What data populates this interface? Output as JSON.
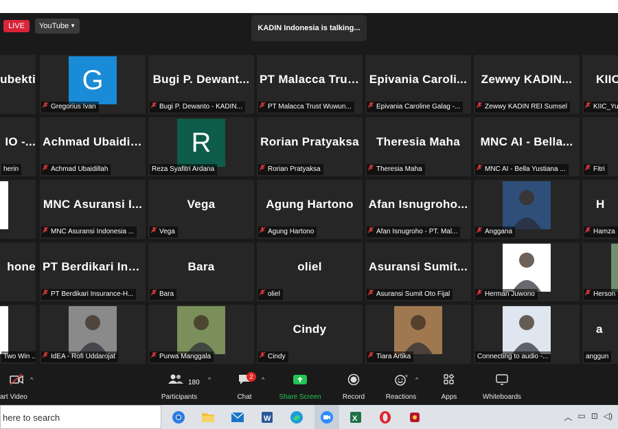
{
  "meeting": {
    "live_label": "LIVE",
    "stream_target": "YouTube",
    "speaker_banner": "KADIN Indonesia is talking..."
  },
  "tiles": [
    {
      "display": "ubekti",
      "label": "",
      "type": "name"
    },
    {
      "display": "G",
      "label": "Gregorius Ivan",
      "type": "avatar",
      "color": "#1a8bd6"
    },
    {
      "display": "Bugi P. Dewant...",
      "label": "Bugi P. Dewanto - KADIN...",
      "type": "name"
    },
    {
      "display": "PT Malacca Trus...",
      "label": "PT Malacca Trust Wuwun...",
      "type": "name"
    },
    {
      "display": "Epivania Caroli...",
      "label": "Epivania Caroline Galag -...",
      "type": "name"
    },
    {
      "display": "Zewwy KADIN...",
      "label": "Zewwy KADIN REI Sumsel",
      "type": "name"
    },
    {
      "display": "KIIC",
      "label": "KIIC_Yu",
      "type": "name"
    },
    {
      "display": "IO -...",
      "label": "herin",
      "type": "name",
      "nomic": true
    },
    {
      "display": "Achmad Ubaidil...",
      "label": "Achmad Ubaidillah",
      "type": "name"
    },
    {
      "display": "R",
      "label": "Reza Syafitri Ardana",
      "type": "avatar",
      "color": "#0e5c4a",
      "nomic": true
    },
    {
      "display": "Rorian Pratyaksa",
      "label": "Rorian Pratyaksa",
      "type": "name"
    },
    {
      "display": "Theresia Maha",
      "label": "Theresia Maha",
      "type": "name"
    },
    {
      "display": "MNC AI - Bella...",
      "label": "MNC AI - Bella Yustiana ...",
      "type": "name"
    },
    {
      "display": "",
      "label": "Fitri",
      "type": "name"
    },
    {
      "display": "",
      "label": "",
      "type": "photo-edge"
    },
    {
      "display": "MNC Asuransi I...",
      "label": "MNC Asuransi Indonesia ...",
      "type": "name"
    },
    {
      "display": "Vega",
      "label": "Vega",
      "type": "name"
    },
    {
      "display": "Agung Hartono",
      "label": "Agung Hartono",
      "type": "name"
    },
    {
      "display": "Afan Isnugroho...",
      "label": "Afan Isnugroho - PT. Mal...",
      "type": "name"
    },
    {
      "display": "",
      "label": "Anggana",
      "type": "photo",
      "color": "#2f4f7a"
    },
    {
      "display": "H",
      "label": "Hamza",
      "type": "name"
    },
    {
      "display": "hone",
      "label": "",
      "type": "name"
    },
    {
      "display": "PT Berdikari Ins...",
      "label": "PT Berdikari Insurance-H...",
      "type": "name"
    },
    {
      "display": "Bara",
      "label": "Bara",
      "type": "name"
    },
    {
      "display": "oliel",
      "label": "oliel",
      "type": "name"
    },
    {
      "display": "Asuransi Sumit...",
      "label": "Asuransi Sumit Oto Fijal",
      "type": "name"
    },
    {
      "display": "",
      "label": "Herman Juwono",
      "type": "photo",
      "color": "#ffffff"
    },
    {
      "display": "",
      "label": "Herson",
      "type": "photo-edge",
      "color": "#6f8f6f"
    },
    {
      "display": "",
      "label": "Two Win ...",
      "type": "photo-edge",
      "nomic": true
    },
    {
      "display": "",
      "label": "IdEA - Rofi Uddarojat",
      "type": "photo",
      "color": "#8a8a8a"
    },
    {
      "display": "",
      "label": "Purwa Manggala",
      "type": "photo",
      "color": "#7b8f5a"
    },
    {
      "display": "Cindy",
      "label": "Cindy",
      "type": "name"
    },
    {
      "display": "",
      "label": "Tiara Artika",
      "type": "photo",
      "color": "#a07850"
    },
    {
      "display": "",
      "label": "Connecting to audio -...",
      "type": "photo",
      "color": "#dfe6ef",
      "nomic": true
    },
    {
      "display": "a",
      "label": "anggun",
      "type": "name",
      "nomic": true
    }
  ],
  "toolbar": {
    "start_video": "art Video",
    "participants_label": "Participants",
    "participants_count": "180",
    "chat_label": "Chat",
    "chat_badge": "2",
    "share_label": "Share Screen",
    "record_label": "Record",
    "reactions_label": "Reactions",
    "apps_label": "Apps",
    "whiteboards_label": "Whiteboards"
  },
  "taskbar": {
    "search_placeholder": "here to search",
    "apps": [
      "chrome-icon",
      "file-explorer-icon",
      "mail-icon",
      "word-icon",
      "edge-icon",
      "zoom-icon",
      "excel-icon",
      "opera-icon",
      "app-icon"
    ]
  },
  "colors": {
    "share_green": "#23c552",
    "mic_muted_red": "#e0393e",
    "live_red": "#d9243a"
  }
}
